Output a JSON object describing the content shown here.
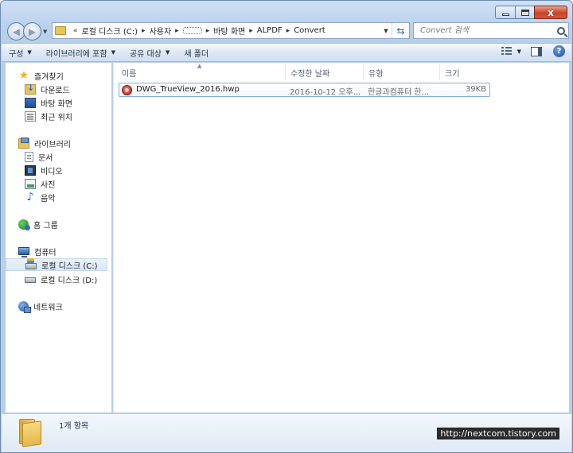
{
  "window": {
    "caption_close": "x"
  },
  "address_bar": {
    "prefix": "«",
    "segments": [
      "로컬 디스크 (C:)",
      "사용자",
      "바탕 화면",
      "ALPDF",
      "Convert"
    ],
    "separator": "▸"
  },
  "search": {
    "placeholder": "Convert 검색"
  },
  "toolbar": {
    "organize": "구성",
    "include_library": "라이브러리에 포함",
    "share_with": "공유 대상",
    "new_folder": "새 폴더",
    "help": "?"
  },
  "sidebar": {
    "favorites": {
      "label": "즐겨찾기",
      "items": [
        {
          "label": "다운로드",
          "icon": "download-folder-icon"
        },
        {
          "label": "바탕 화면",
          "icon": "desktop-icon"
        },
        {
          "label": "최근 위치",
          "icon": "recent-places-icon"
        }
      ]
    },
    "libraries": {
      "label": "라이브러리",
      "items": [
        {
          "label": "문서",
          "icon": "documents-icon"
        },
        {
          "label": "비디오",
          "icon": "videos-icon"
        },
        {
          "label": "사진",
          "icon": "pictures-icon"
        },
        {
          "label": "음악",
          "icon": "music-icon"
        }
      ]
    },
    "homegroup": {
      "label": "홈 그룹"
    },
    "computer": {
      "label": "컴퓨터",
      "items": [
        {
          "label": "로컬 디스크 (C:)",
          "icon": "drive-c-icon",
          "selected": true
        },
        {
          "label": "로컬 디스크 (D:)",
          "icon": "drive-d-icon",
          "selected": false
        }
      ]
    },
    "network": {
      "label": "네트워크"
    }
  },
  "columns": {
    "name": "이름",
    "date_modified": "수정한 날짜",
    "type": "유형",
    "size": "크기"
  },
  "files": [
    {
      "name": "DWG_TrueView_2016.hwp",
      "date_modified": "2016-10-12 오후...",
      "type": "한글과컴퓨터 한...",
      "size": "39KB",
      "icon": "hwp-file-icon"
    }
  ],
  "details": {
    "item_count": "1개 항목"
  },
  "watermark": "http://nextcom.tistory.com"
}
